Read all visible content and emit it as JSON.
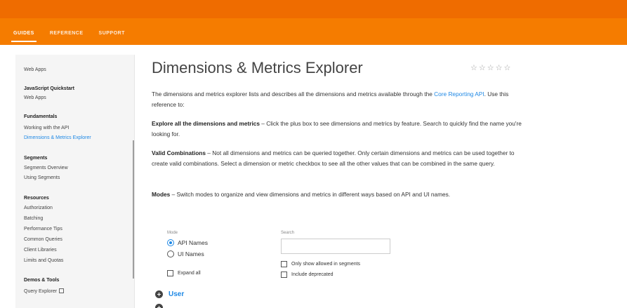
{
  "header": {
    "tabs": [
      {
        "label": "GUIDES",
        "active": true
      },
      {
        "label": "REFERENCE",
        "active": false
      },
      {
        "label": "SUPPORT",
        "active": false
      }
    ],
    "color": "#f57c00"
  },
  "sidebar": {
    "web_apps_top": "Web Apps",
    "js_quickstart_heading": "JavaScript Quickstart",
    "js_web_apps": "Web Apps",
    "fundamentals_heading": "Fundamentals",
    "working_with_api": "Working with the API",
    "dimensions_explorer": "Dimensions & Metrics Explorer",
    "segments_heading": "Segments",
    "segments_overview": "Segments Overview",
    "using_segments": "Using Segments",
    "resources_heading": "Resources",
    "authorization": "Authorization",
    "batching": "Batching",
    "performance_tips": "Performance Tips",
    "common_queries": "Common Queries",
    "client_libraries": "Client Libraries",
    "limits_quotas": "Limits and Quotas",
    "demos_heading": "Demos & Tools",
    "query_explorer": "Query Explorer"
  },
  "main": {
    "title": "Dimensions & Metrics Explorer",
    "rating_stars": 5,
    "intro_before": "The dimensions and metrics explorer lists and describes all the dimensions and metrics available through the",
    "intro_link": "Core Reporting API",
    "intro_after": ". Use this reference to:",
    "explore_bold": "Explore all the dimensions and metrics",
    "explore_text": " – Click the plus box to see dimensions and metrics by feature. Search to quickly find the name you're looking for.",
    "valid_bold": "Valid Combinations",
    "valid_text": " – Not all dimensions and metrics can be queried together. Only certain dimensions and metrics can be used together to create valid combinations. Select a dimension or metric checkbox to see all the other values that can be combined in the same query.",
    "modes_bold": "Modes",
    "modes_text": " – Switch modes to organize and view dimensions and metrics in different ways based on API and UI names."
  },
  "controls": {
    "mode_label": "Mode",
    "mode_options": [
      {
        "label": "API Names",
        "checked": true
      },
      {
        "label": "UI Names",
        "checked": false
      }
    ],
    "expand_all": "Expand all",
    "search_label": "Search",
    "search_value": "",
    "only_allowed_segments": "Only show allowed in segments",
    "include_deprecated": "Include deprecated"
  },
  "groups": [
    {
      "label": "User"
    }
  ]
}
